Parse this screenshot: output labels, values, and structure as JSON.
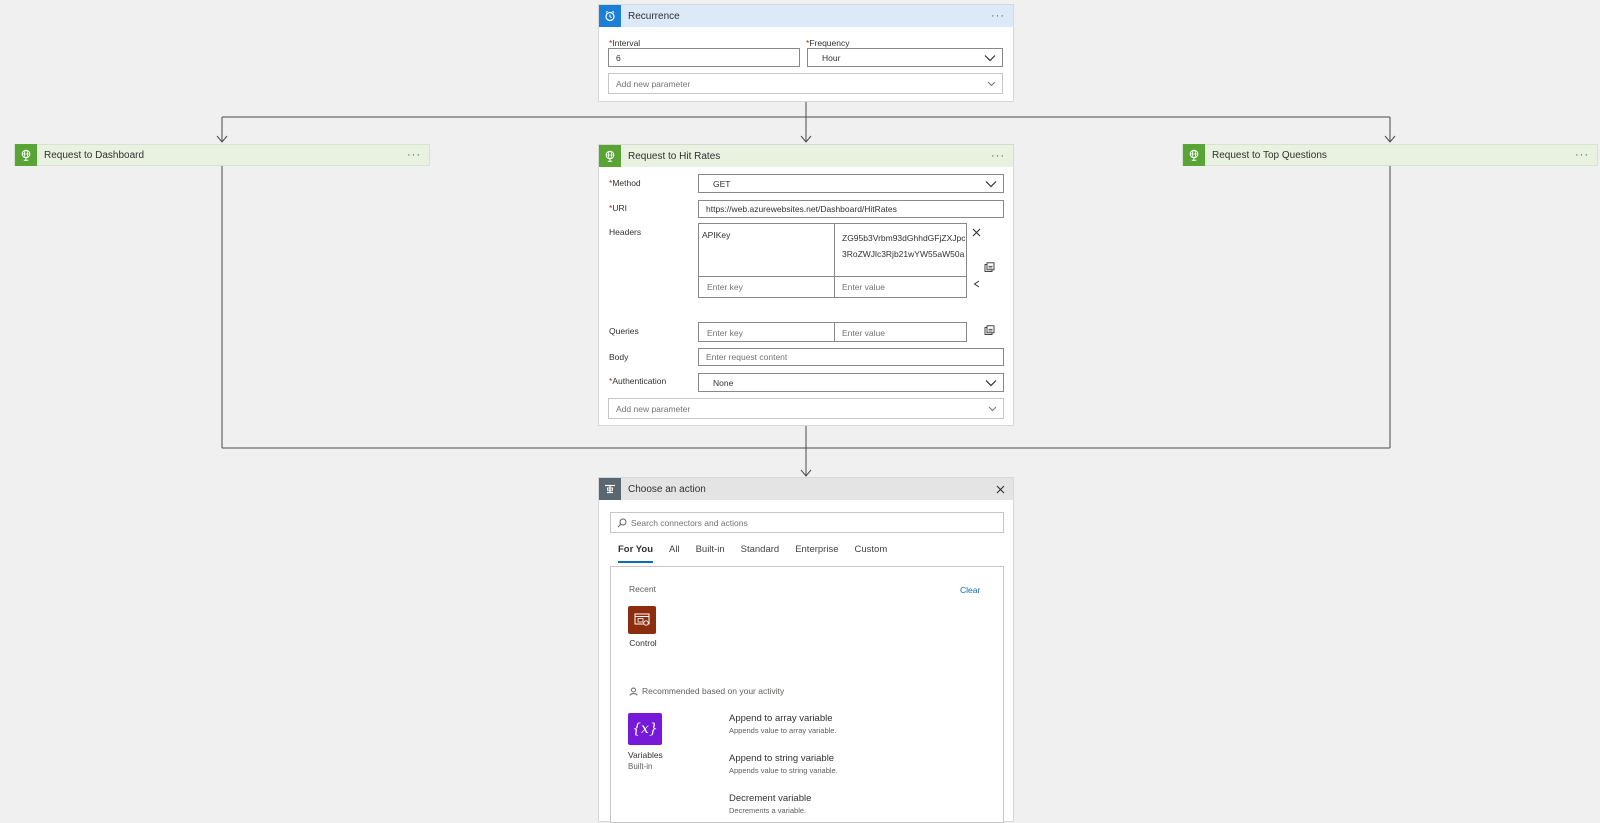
{
  "recurrence": {
    "title": "Recurrence",
    "more": "···",
    "interval_label": "Interval",
    "interval_value": "6",
    "frequency_label": "Frequency",
    "frequency_value": "Hour",
    "add_param": "Add new parameter",
    "required_mark": "*"
  },
  "branches": {
    "dashboard": {
      "title": "Request to Dashboard",
      "more": "···"
    },
    "top_questions": {
      "title": "Request to Top Questions",
      "more": "···"
    }
  },
  "hit_rates": {
    "title": "Request to Hit Rates",
    "more": "···",
    "method_label": "Method",
    "method_value": "GET",
    "uri_label": "URI",
    "uri_value": "https://web.azurewebsites.net/Dashboard/HitRates",
    "headers_label": "Headers",
    "header_key": "APIKey",
    "header_value_line1": "ZG95b3Vrbm93dGhhdGFjZXJpc",
    "header_value_line2": "3RoZWJlc3Rjb21wYW55aW50a",
    "enter_key": "Enter key",
    "enter_value": "Enter value",
    "queries_label": "Queries",
    "body_label": "Body",
    "body_placeholder": "Enter request content",
    "auth_label": "Authentication",
    "auth_value": "None",
    "add_param": "Add new parameter",
    "required_mark": "*"
  },
  "choose_action": {
    "title": "Choose an action",
    "search_placeholder": "Search connectors and actions",
    "tabs": [
      "For You",
      "All",
      "Built-in",
      "Standard",
      "Enterprise",
      "Custom"
    ],
    "recent_label": "Recent",
    "clear_label": "Clear",
    "recent_tile": "Control",
    "recommended_label": "Recommended based on your activity",
    "variables_tile_line1": "Variables",
    "variables_tile_line2": "Built-in",
    "variables_glyph": "{x}",
    "actions": [
      {
        "name": "Append to array variable",
        "desc": "Appends value to array variable."
      },
      {
        "name": "Append to string variable",
        "desc": "Appends value to string variable."
      },
      {
        "name": "Decrement variable",
        "desc": "Decrements a variable."
      }
    ]
  },
  "colors": {
    "recurrence_accent": "#1a7fd5",
    "http_accent": "#58a536",
    "control_tile": "#8c2d0d",
    "variables_tile": "#7719d9",
    "link": "#0f6cbd",
    "required": "#a4262c"
  },
  "icons": {
    "recurrence": "alarm-clock-icon",
    "http": "globe-icon",
    "choose_action": "operation-icon"
  }
}
